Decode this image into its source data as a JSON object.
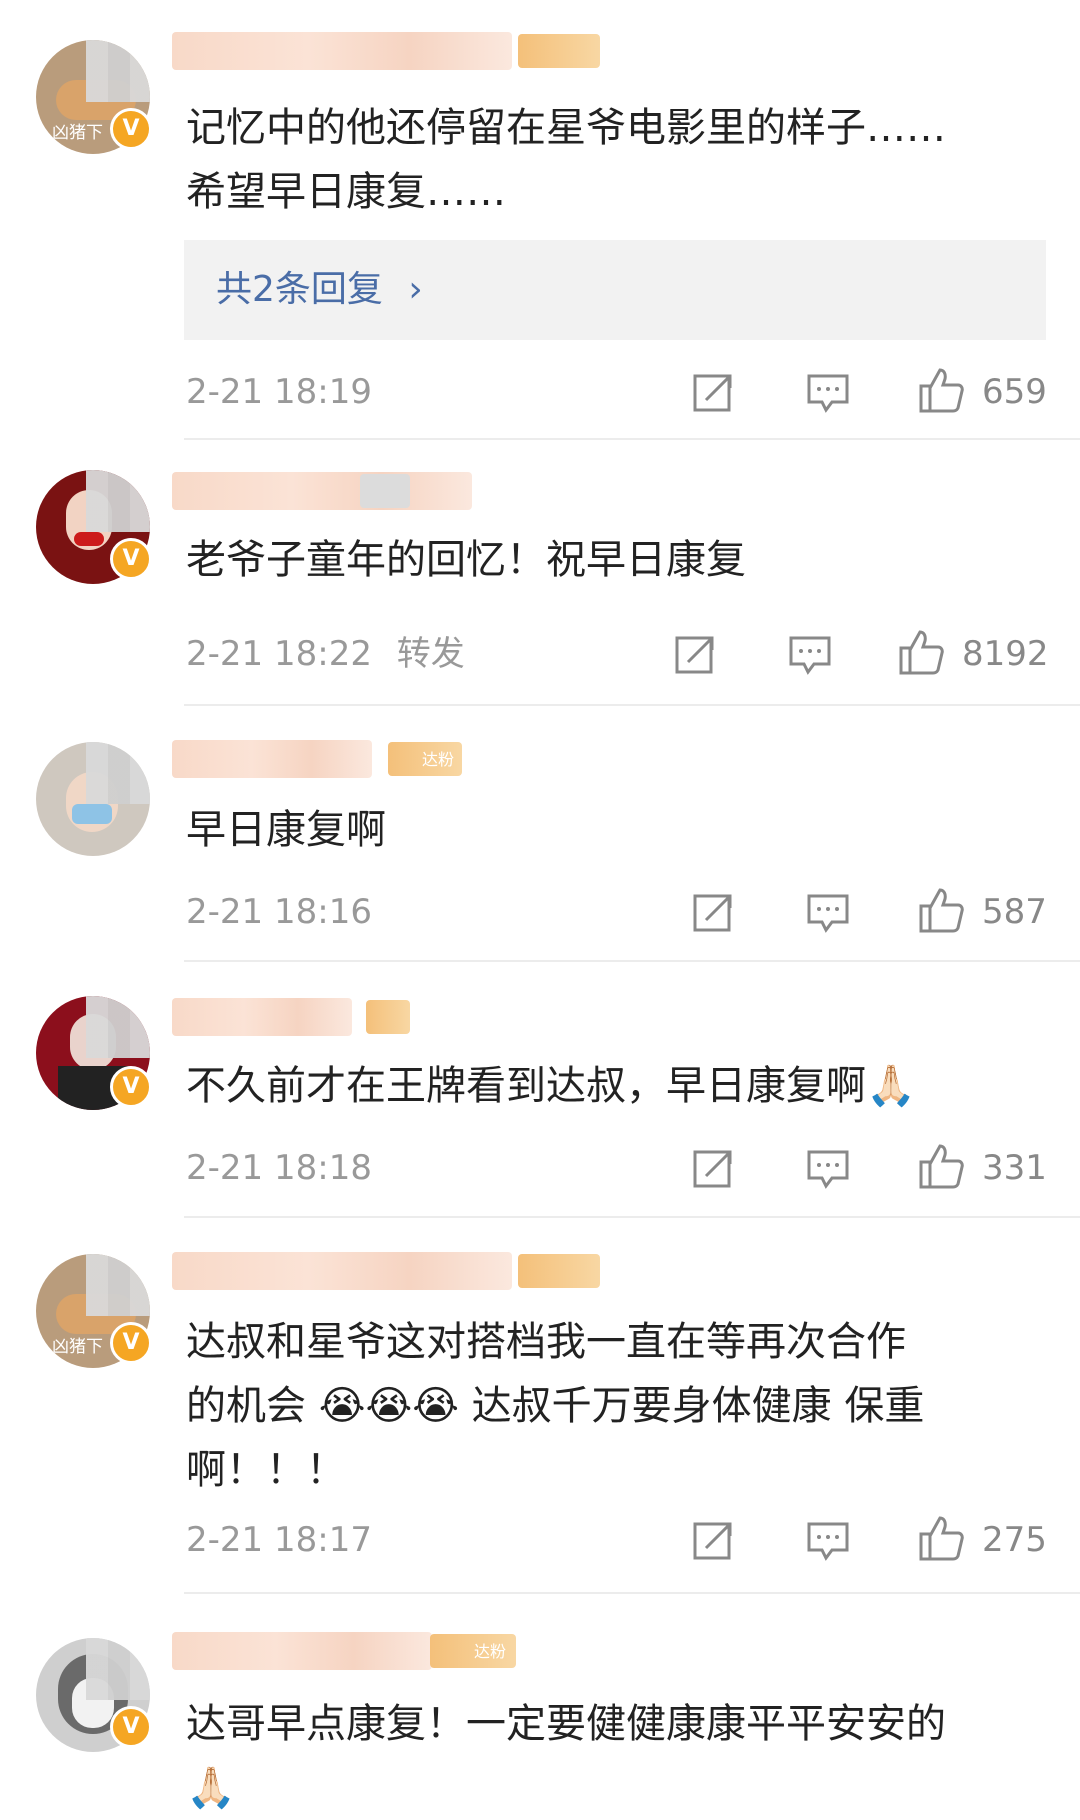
{
  "comments": [
    {
      "avatar_label": "凶猪下",
      "text_lines": [
        "记忆中的他还停留在星爷电影里的样子……",
        "希望早日康复……"
      ],
      "replies_label": "共2条回复",
      "time": "2-21 18:19",
      "forward_label": "",
      "likes": "659"
    },
    {
      "avatar_label": "",
      "text_lines": [
        "老爷子童年的回忆！祝早日康复"
      ],
      "replies_label": "",
      "time": "2-21 18:22",
      "forward_label": "转发",
      "likes": "8192"
    },
    {
      "avatar_label": "",
      "badge": "达粉",
      "text_lines": [
        "早日康复啊"
      ],
      "replies_label": "",
      "time": "2-21 18:16",
      "forward_label": "",
      "likes": "587"
    },
    {
      "avatar_label": "",
      "text_lines": [
        "不久前才在王牌看到达叔，早日康复啊🙏🏻"
      ],
      "replies_label": "",
      "time": "2-21 18:18",
      "forward_label": "",
      "likes": "331"
    },
    {
      "avatar_label": "凶猪下",
      "text_lines": [
        "达叔和星爷这对搭档我一直在等再次合作",
        "的机会 😭😭😭 达叔千万要身体健康 保重",
        "啊！！！"
      ],
      "replies_label": "",
      "time": "2-21 18:17",
      "forward_label": "",
      "likes": "275"
    },
    {
      "avatar_label": "",
      "badge": "达粉",
      "text_lines": [
        "达哥早点康复！一定要健健康康平平安安的",
        "🙏🏻"
      ],
      "replies_label": "",
      "time": "",
      "forward_label": "",
      "likes": ""
    }
  ],
  "icons": {
    "share": "share-icon",
    "comment": "comment-icon",
    "like": "thumbs-up-icon",
    "verified": "verified-badge-icon"
  },
  "colors": {
    "reply_link": "#4a6da7",
    "verified": "#f5a623",
    "meta": "#999999"
  }
}
